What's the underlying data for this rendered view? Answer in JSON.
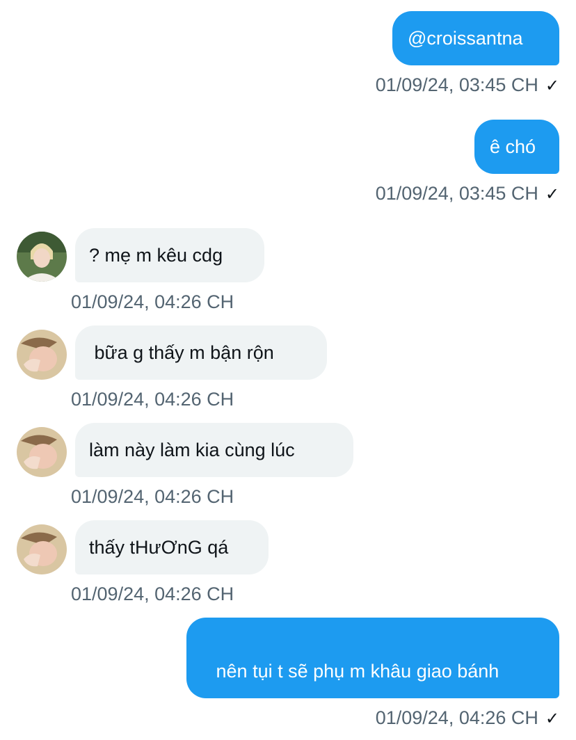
{
  "messages": [
    {
      "text": "@croissantna",
      "time": "01/09/24, 03:45 CH"
    },
    {
      "text": "ê chó",
      "time": "01/09/24, 03:45 CH"
    },
    {
      "text": "? mẹ m kêu cdg",
      "time": "01/09/24, 04:26 CH"
    },
    {
      "text": " bữa g thấy m bận rộn",
      "time": "01/09/24, 04:26 CH"
    },
    {
      "text": "làm này làm kia cùng lúc",
      "time": "01/09/24, 04:26 CH"
    },
    {
      "text": "thấy tHưƠnG qá",
      "time": "01/09/24, 04:26 CH"
    },
    {
      "text": " nên tụi t sẽ phụ m khâu giao bánh",
      "time": "01/09/24, 04:26 CH"
    }
  ],
  "read_mark": "✓",
  "colors": {
    "outgoing_bubble": "#1d9bf0",
    "incoming_bubble": "#eff3f4",
    "timestamp": "#536471"
  }
}
